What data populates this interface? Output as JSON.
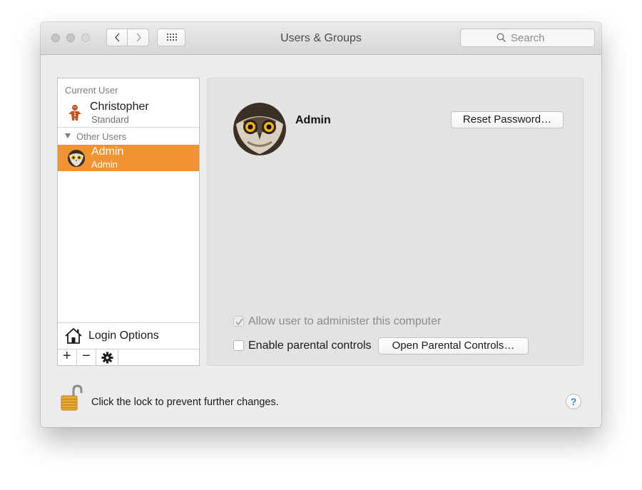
{
  "window": {
    "title": "Users & Groups",
    "search_placeholder": "Search"
  },
  "sidebar": {
    "current_user_label": "Current User",
    "current_user": {
      "name": "Christopher",
      "role": "Standard",
      "icon": "gingerbread-avatar-icon"
    },
    "other_users_label": "Other Users",
    "other_users": [
      {
        "name": "Admin",
        "role": "Admin",
        "icon": "owl-avatar-icon",
        "selected": true
      }
    ],
    "login_options_label": "Login Options",
    "toolbar": {
      "add_label": "+",
      "remove_label": "−"
    }
  },
  "panel": {
    "user_name": "Admin",
    "reset_password_label": "Reset Password…",
    "allow_admin_label": "Allow user to administer this computer",
    "allow_admin_checked": true,
    "parental_controls_label": "Enable parental controls",
    "parental_controls_checked": false,
    "open_parental_label": "Open Parental Controls…"
  },
  "footer": {
    "lock_text": "Click the lock to prevent further changes.",
    "help_label": "?"
  },
  "colors": {
    "selection": "#f09332",
    "help_accent": "#3b82e8"
  }
}
